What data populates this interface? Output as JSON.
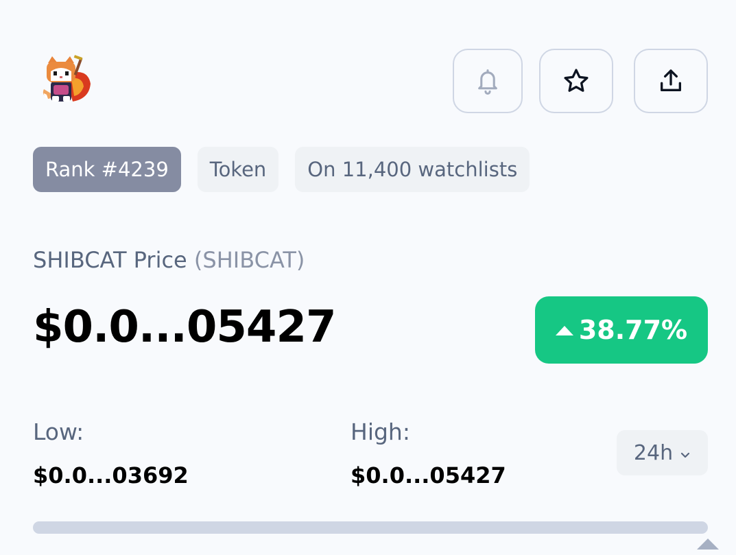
{
  "header": {
    "logo_icon": "shibcat-logo",
    "buttons": [
      {
        "icon": "bell-icon"
      },
      {
        "icon": "star-icon"
      },
      {
        "icon": "share-icon"
      }
    ]
  },
  "tags": {
    "rank": "Rank #4239",
    "type": "Token",
    "watchlists": "On 11,400 watchlists"
  },
  "price": {
    "label": "SHIBCAT Price",
    "symbol": "(SHIBCAT)",
    "value": "$0.0...05427",
    "change": "38.77%",
    "change_direction": "up",
    "change_color": "#16c784"
  },
  "range": {
    "low_label": "Low:",
    "low_value": "$0.0...03692",
    "high_label": "High:",
    "high_value": "$0.0...05427",
    "period": "24h",
    "position_fraction": 1.0
  }
}
